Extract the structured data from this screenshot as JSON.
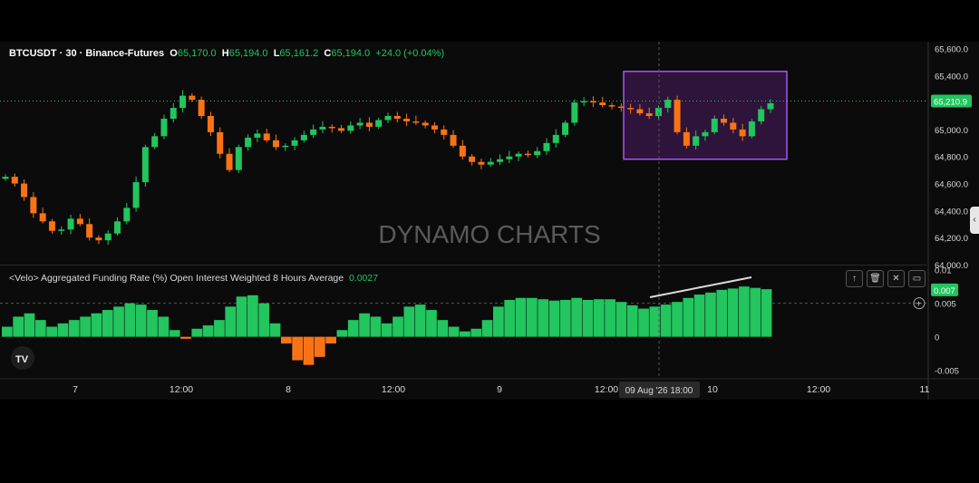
{
  "header": {
    "symbol": "BTCUSDT · 30 · Binance-Futures",
    "open_label": "O",
    "open": "65,170.0",
    "high_label": "H",
    "high": "65,194.0",
    "low_label": "L",
    "low": "65,161.2",
    "close_label": "C",
    "close": "65,194.0",
    "change": "+24.0 (+0.04%)"
  },
  "watermark": "DYNAMO CHARTS",
  "indicator": {
    "title": "<Velo> Aggregated Funding Rate (%) Open Interest Weighted 8 Hours Average",
    "value": "0.0027"
  },
  "colors": {
    "background": "#0b0b0b",
    "up": "#22c55e",
    "down": "#f97316",
    "highlight_box": "#a855f7",
    "price_line": "#22c55e",
    "histogram_positive": "#22c55e",
    "histogram_negative": "#f97316"
  },
  "icons": [
    "arrow-up-icon",
    "trash-icon",
    "collapse-icon",
    "maximize-icon",
    "tradingview-logo-icon",
    "plus-circle-icon",
    "chevron-left-icon"
  ],
  "chart_data": [
    {
      "type": "candlestick",
      "title": "",
      "ylabel": "",
      "y_ticks": [
        "65,600.0",
        "65,400.0",
        "65,200.0",
        "65,000.0",
        "64,800.0",
        "64,600.0",
        "64,400.0",
        "64,200.0",
        "64,000.0"
      ],
      "x_ticks": [
        "7",
        "12:00",
        "8",
        "12:00",
        "9",
        "12:00",
        "10",
        "12:00",
        "11"
      ],
      "crosshair_x_label": "09 Aug '26   18:00",
      "ylim": [
        64000,
        65650
      ],
      "last_price_label": "65,210.9",
      "last_price": 65210.9,
      "close_path": [
        64650,
        64600,
        64500,
        64380,
        64320,
        64250,
        64260,
        64340,
        64300,
        64200,
        64180,
        64230,
        64320,
        64420,
        64610,
        64870,
        64950,
        65080,
        65160,
        65250,
        65220,
        65100,
        64980,
        64820,
        64700,
        64870,
        64940,
        64970,
        64920,
        64870,
        64880,
        64920,
        64960,
        65000,
        65020,
        65010,
        64990,
        65030,
        65050,
        65020,
        65070,
        65100,
        65080,
        65060,
        65050,
        65030,
        65000,
        64960,
        64880,
        64800,
        64760,
        64740,
        64760,
        64780,
        64800,
        64820,
        64810,
        64840,
        64900,
        64960,
        65050,
        65200,
        65210,
        65200,
        65180,
        65170,
        65160,
        65150,
        65120,
        65100,
        65160,
        65220,
        64980,
        64880,
        64950,
        64980,
        65080,
        65050,
        65000,
        64950,
        65060,
        65150,
        65194
      ],
      "highlight_box_range": {
        "price_low": 64780,
        "price_high": 65430
      }
    },
    {
      "type": "bar",
      "title": "<Velo> Aggregated Funding Rate (%) Open Interest Weighted 8 Hours Average",
      "y_ticks": [
        "0.01",
        "0.007",
        "0.005",
        "0",
        "-0.005"
      ],
      "ylim": [
        -0.006,
        0.0105
      ],
      "reference_line": 0.005,
      "last_value_label": "0.007",
      "values": [
        0.0015,
        0.003,
        0.0035,
        0.0025,
        0.0015,
        0.002,
        0.0025,
        0.003,
        0.0035,
        0.004,
        0.0045,
        0.005,
        0.0048,
        0.004,
        0.003,
        0.001,
        -0.0003,
        0.0012,
        0.0017,
        0.0025,
        0.0045,
        0.006,
        0.0062,
        0.005,
        0.002,
        -0.001,
        -0.0035,
        -0.0042,
        -0.003,
        -0.001,
        0.001,
        0.0025,
        0.0035,
        0.003,
        0.002,
        0.003,
        0.0045,
        0.0048,
        0.004,
        0.0025,
        0.0015,
        0.0008,
        0.0012,
        0.0025,
        0.0045,
        0.0055,
        0.0058,
        0.0058,
        0.0056,
        0.0054,
        0.0055,
        0.0058,
        0.0055,
        0.0056,
        0.0056,
        0.0052,
        0.0047,
        0.0042,
        0.0045,
        0.0048,
        0.0052,
        0.0058,
        0.0063,
        0.0066,
        0.007,
        0.0072,
        0.0075,
        0.0073,
        0.0071
      ]
    }
  ]
}
